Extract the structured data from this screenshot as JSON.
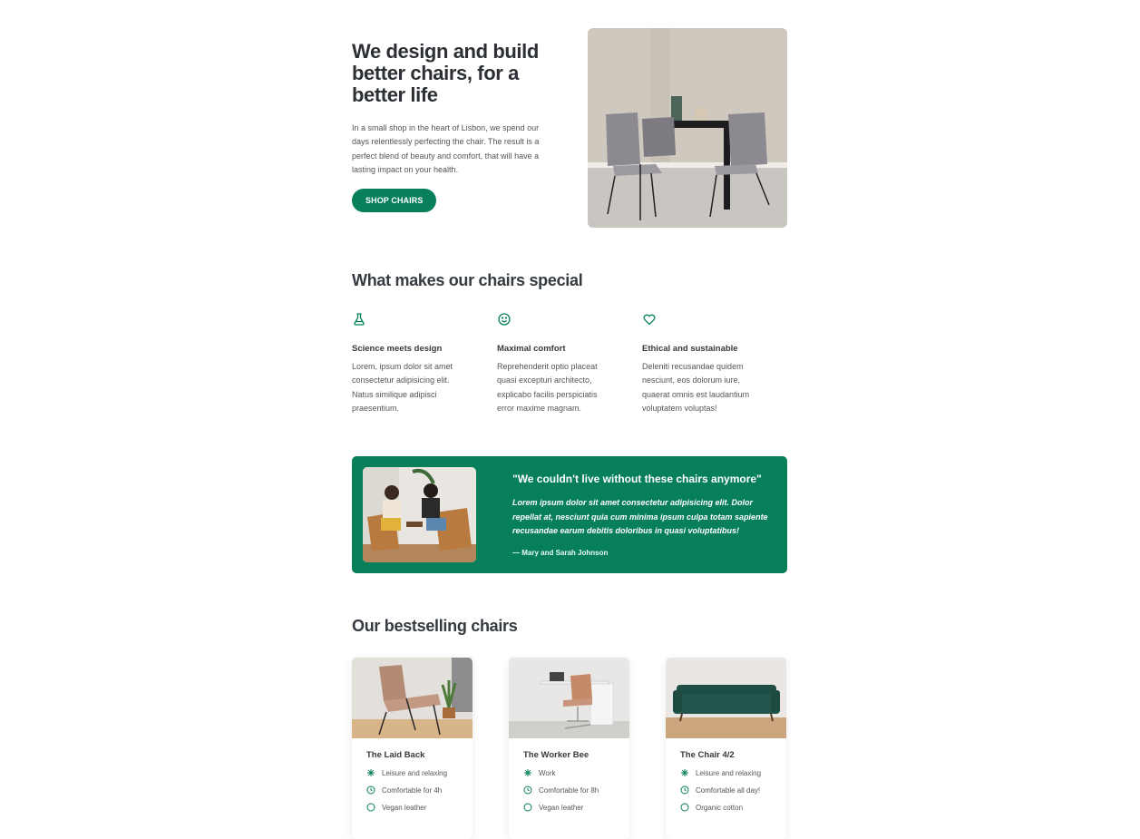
{
  "hero": {
    "title": "We design and build better chairs, for a better life",
    "description": "In a small shop in the heart of Lisbon, we spend our days relentlessly perfecting the chair. The result is a perfect blend of beauty and comfort, that will have a lasting impact on your health.",
    "cta_label": "SHOP CHAIRS",
    "image_alt": "dining-room-chairs"
  },
  "features": {
    "title": "What makes our chairs special",
    "items": [
      {
        "icon": "flask-icon",
        "title": "Science meets design",
        "text": "Lorem, ipsum dolor sit amet consectetur adipisicing elit. Natus similique adipisci praesentium."
      },
      {
        "icon": "smile-icon",
        "title": "Maximal comfort",
        "text": "Reprehenderit optio placeat quasi excepturi architecto, explicabo facilis perspiciatis error maxime magnam."
      },
      {
        "icon": "heart-icon",
        "title": "Ethical and sustainable",
        "text": "Deleniti recusandae quidem nesciunt, eos dolorum iure, quaerat omnis est laudantium voluptatem voluptas!"
      }
    ]
  },
  "testimonial": {
    "quote": "\"We couldn't live without these chairs anymore\"",
    "text": "Lorem ipsum dolor sit amet consectetur adipisicing elit. Dolor repellat at, nesciunt quia cum minima ipsum culpa totam sapiente recusandae earum debitis doloribus in quasi voluptatibus!",
    "author": "— Mary and Sarah Johnson"
  },
  "bestsellers": {
    "title": "Our bestselling chairs",
    "products": [
      {
        "name": "The Laid Back",
        "attrs": [
          {
            "icon": "sparkle-icon",
            "text": "Leisure and relaxing"
          },
          {
            "icon": "clock-icon",
            "text": "Comfortable for 4h"
          },
          {
            "icon": "leaf-icon",
            "text": "Vegan leather"
          }
        ]
      },
      {
        "name": "The Worker Bee",
        "attrs": [
          {
            "icon": "sparkle-icon",
            "text": "Work"
          },
          {
            "icon": "clock-icon",
            "text": "Comfortable for 8h"
          },
          {
            "icon": "leaf-icon",
            "text": "Vegan leather"
          }
        ]
      },
      {
        "name": "The Chair 4/2",
        "attrs": [
          {
            "icon": "sparkle-icon",
            "text": "Leisure and relaxing"
          },
          {
            "icon": "clock-icon",
            "text": "Comfortable all day!"
          },
          {
            "icon": "leaf-icon",
            "text": "Organic cotton"
          }
        ]
      }
    ]
  },
  "colors": {
    "accent": "#087f5b",
    "text": "#343a40",
    "muted": "#555555"
  }
}
